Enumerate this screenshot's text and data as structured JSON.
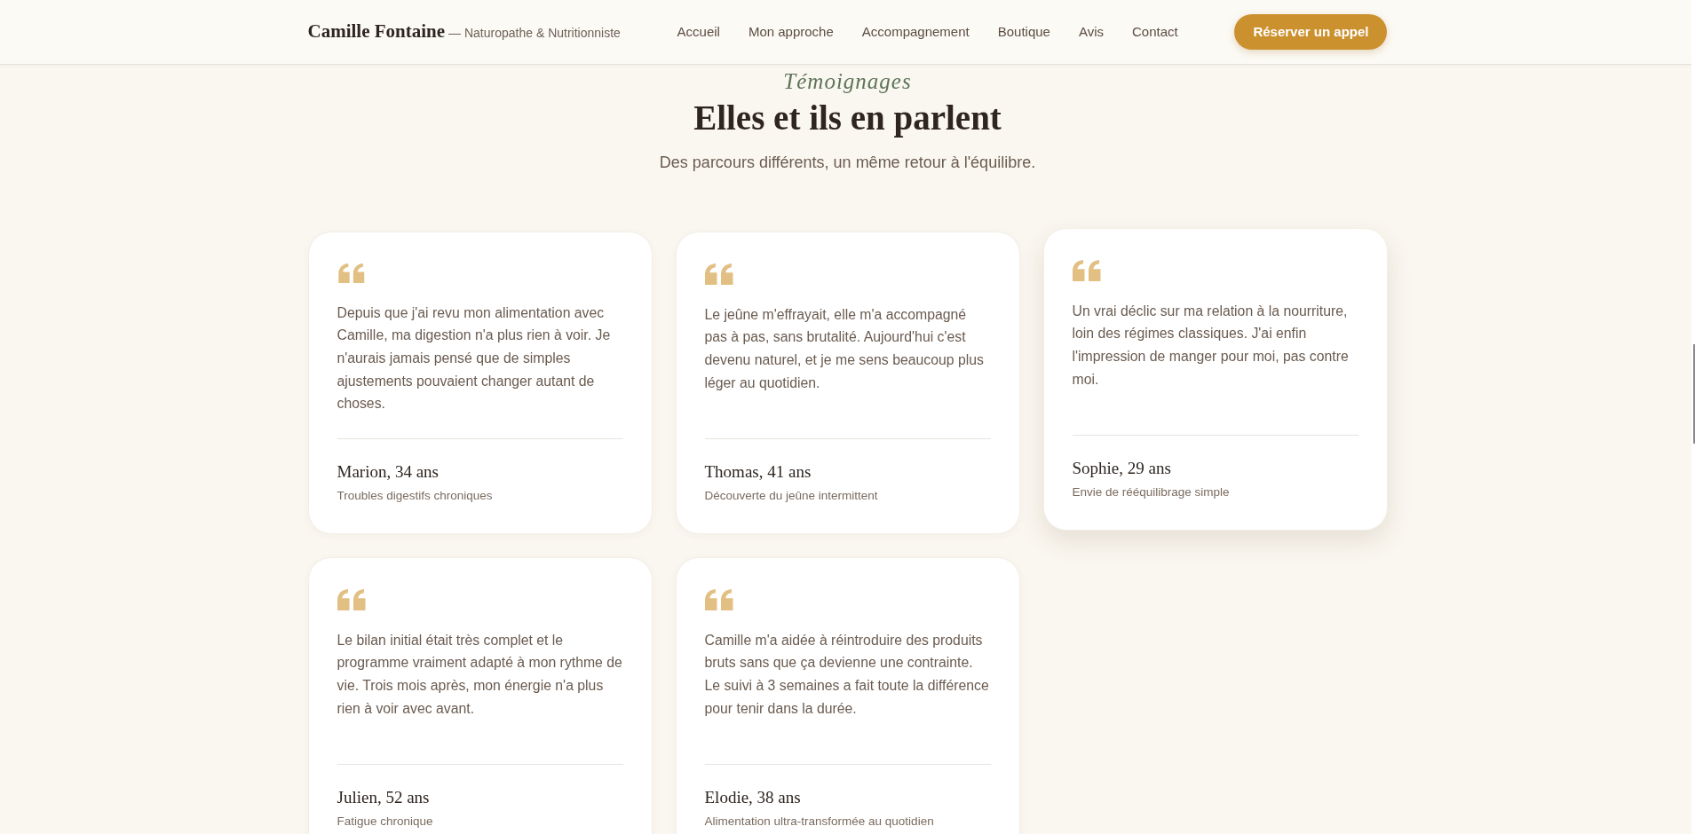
{
  "header": {
    "brand": "Camille Fontaine",
    "tagline": "— Naturopathe & Nutritionniste",
    "nav": [
      "Accueil",
      "Mon approche",
      "Accompagnement",
      "Boutique",
      "Avis",
      "Contact"
    ],
    "cta": "Réserver un appel"
  },
  "section": {
    "eyebrow": "Témoignages",
    "title": "Elles et ils en parlent",
    "subtitle": "Des parcours différents, un même retour à l'équilibre."
  },
  "testimonials": [
    {
      "quote": "Depuis que j'ai revu mon alimentation avec Camille, ma digestion n'a plus rien à voir. Je n'aurais jamais pensé que de simples ajustements pouvaient changer autant de choses.",
      "author": "Marion, 34 ans",
      "context": "Troubles digestifs chroniques",
      "hovered": false
    },
    {
      "quote": "Le jeûne m'effrayait, elle m'a accompagné pas à pas, sans brutalité. Aujourd'hui c'est devenu naturel, et je me sens beaucoup plus léger au quotidien.",
      "author": "Thomas, 41 ans",
      "context": "Découverte du jeûne intermittent",
      "hovered": false
    },
    {
      "quote": "Un vrai déclic sur ma relation à la nourriture, loin des régimes classiques. J'ai enfin l'impression de manger pour moi, pas contre moi.",
      "author": "Sophie, 29 ans",
      "context": "Envie de rééquilibrage simple",
      "hovered": true
    },
    {
      "quote": "Le bilan initial était très complet et le programme vraiment adapté à mon rythme de vie. Trois mois après, mon énergie n'a plus rien à voir avec avant.",
      "author": "Julien, 52 ans",
      "context": "Fatigue chronique",
      "hovered": false
    },
    {
      "quote": "Camille m'a aidée à réintroduire des produits bruts sans que ça devienne une contrainte. Le suivi à 3 semaines a fait toute la différence pour tenir dans la durée.",
      "author": "Elodie, 38 ans",
      "context": "Alimentation ultra-transformée au quotidien",
      "hovered": false
    }
  ]
}
